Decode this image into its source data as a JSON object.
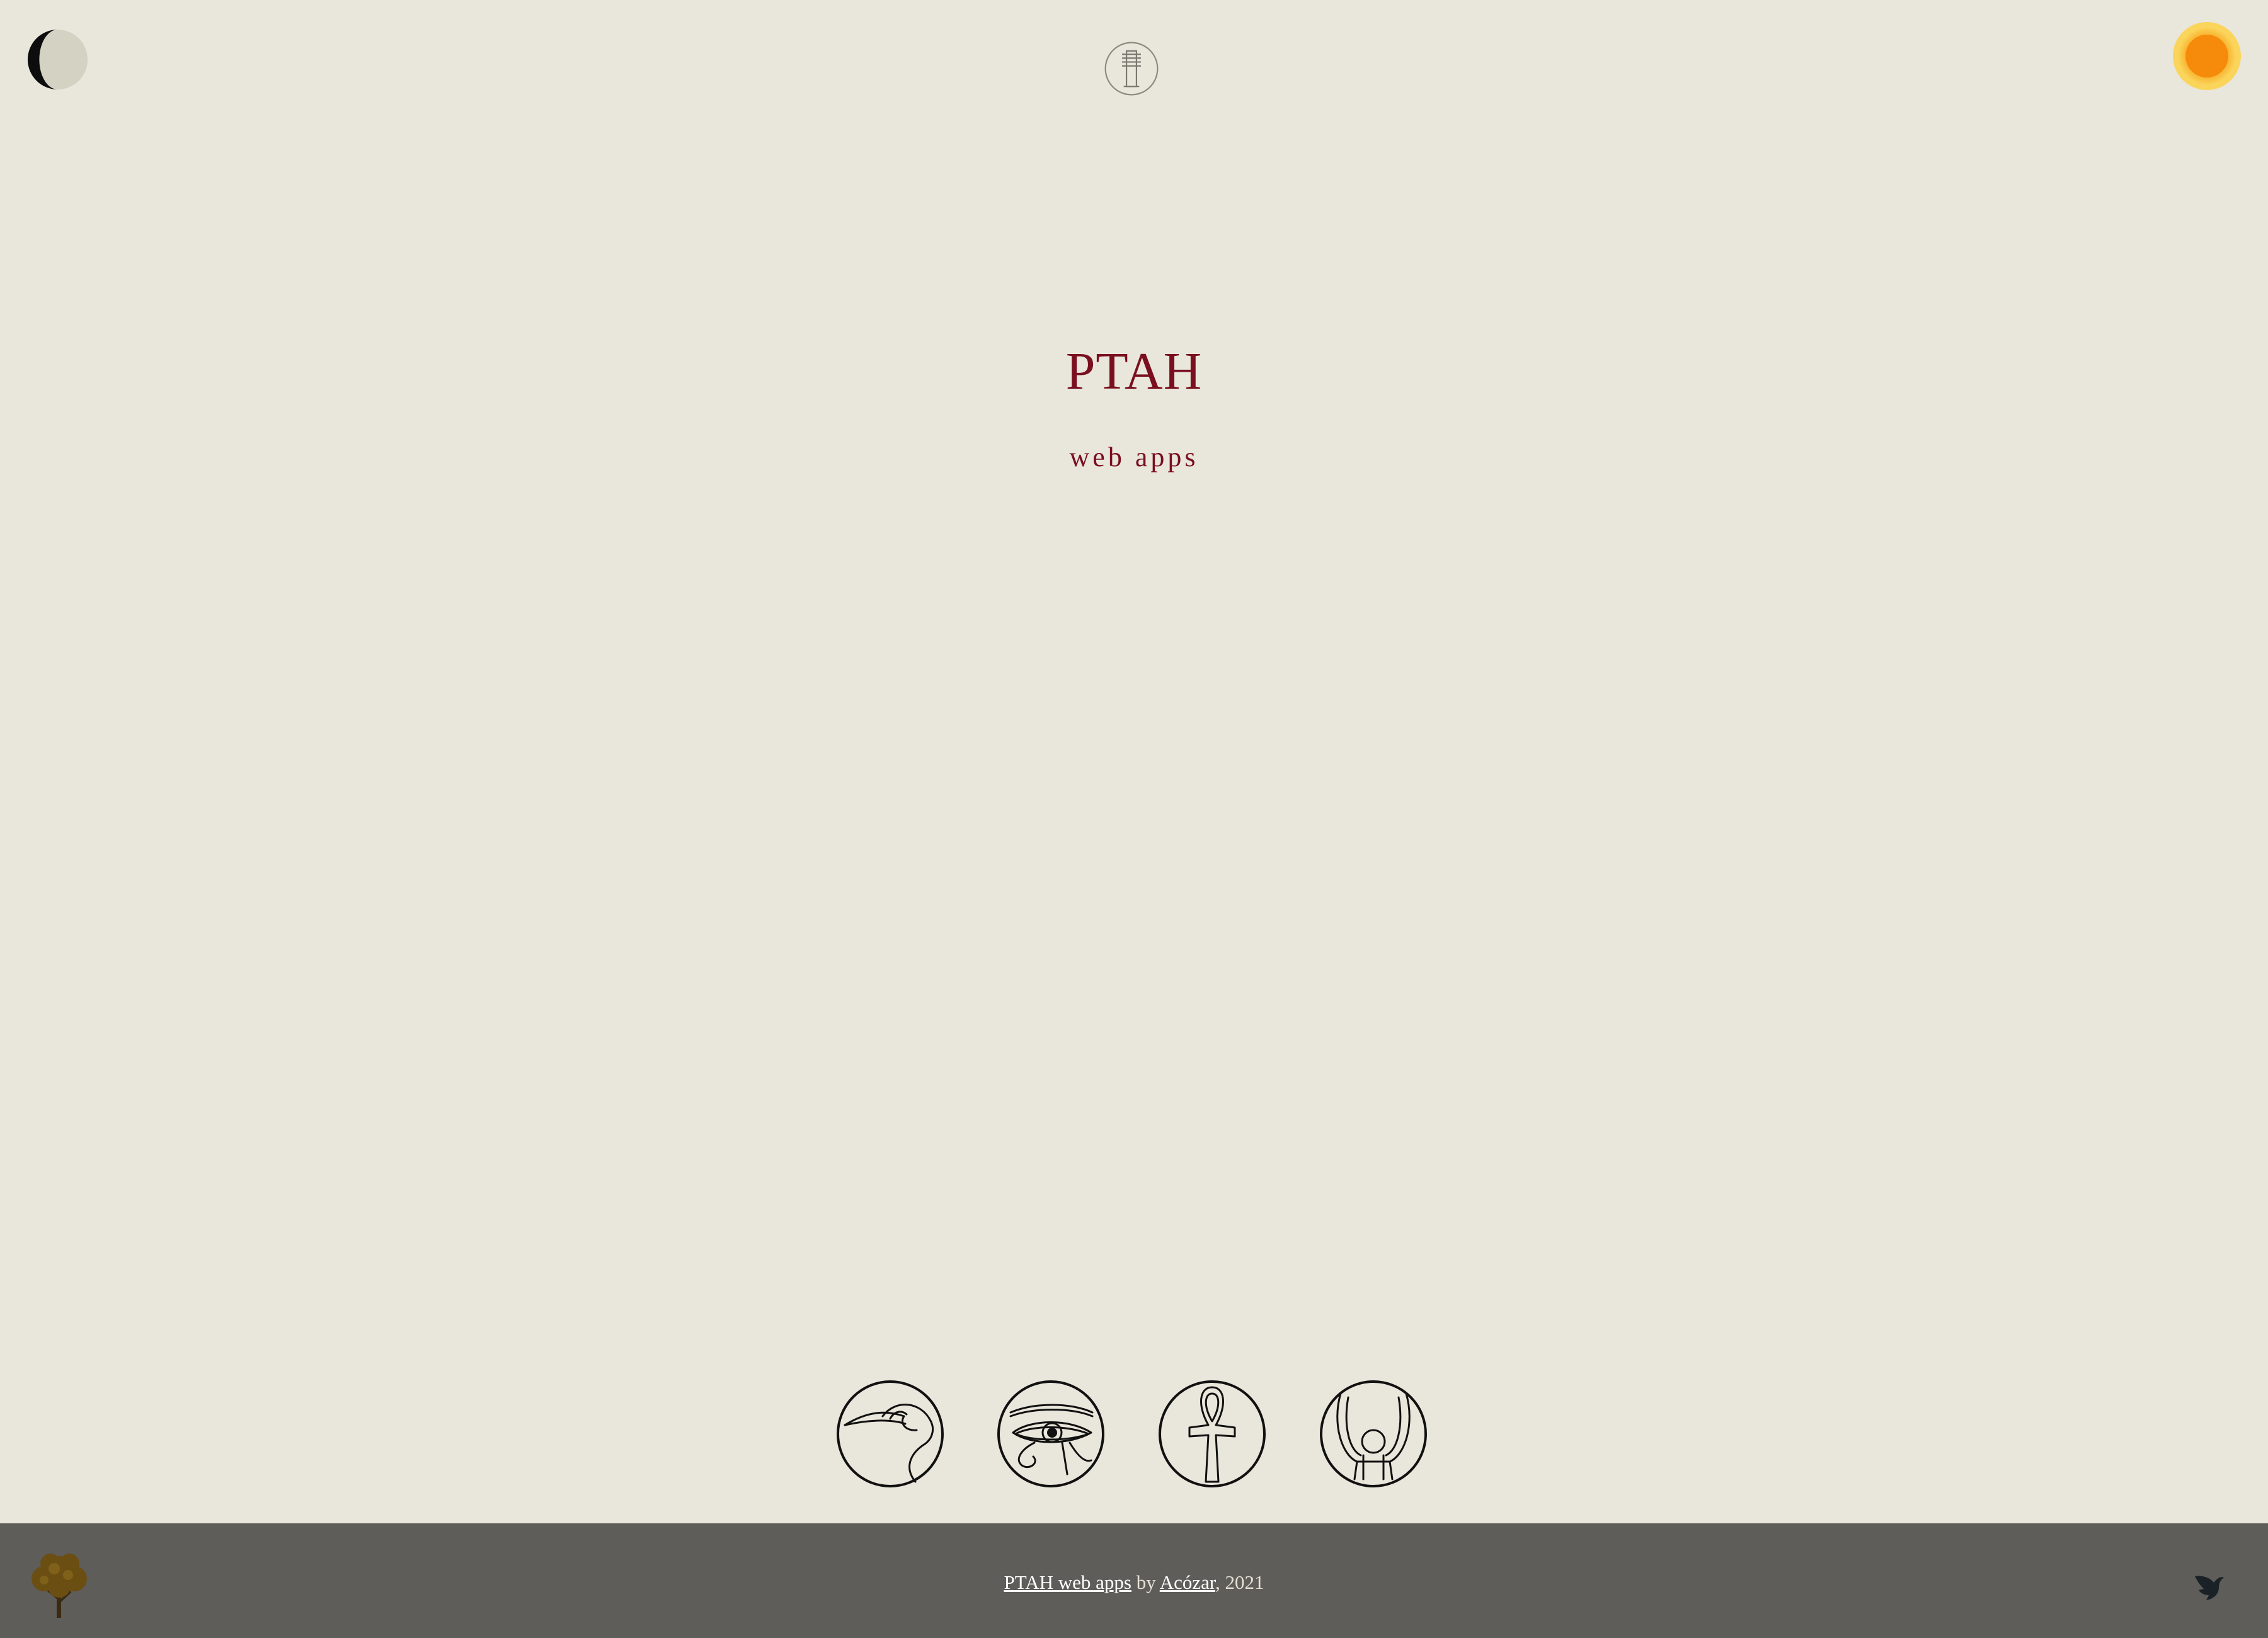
{
  "header": {
    "theme_dark_icon": "crescent-moon-icon",
    "home_icon": "djed-pillar-icon",
    "theme_light_icon": "sun-icon"
  },
  "main": {
    "title": "PTAH",
    "subtitle": "web apps"
  },
  "apps": [
    {
      "icon": "ibis-icon"
    },
    {
      "icon": "eye-of-horus-icon"
    },
    {
      "icon": "ankh-icon"
    },
    {
      "icon": "hathor-crown-icon"
    }
  ],
  "footer": {
    "site_link": "PTAH web apps",
    "by_text": " by ",
    "author_link": "Acózar",
    "year_text": ", 2021",
    "left_icon": "tree-icon",
    "right_icon": "bird-icon"
  },
  "colors": {
    "background": "#e9e6db",
    "accent": "#7a0f1f",
    "footer": "#5e5d59",
    "sun": "#f7a51c"
  }
}
